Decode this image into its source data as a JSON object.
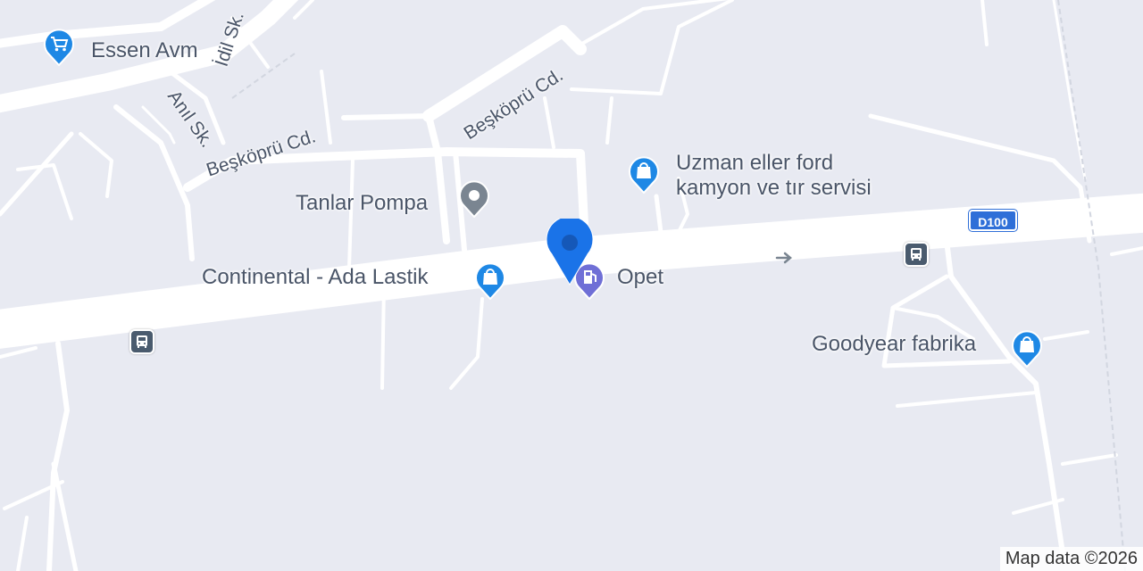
{
  "map": {
    "attribution": "Map data ©2026",
    "colors": {
      "background": "#e8eaf2",
      "road": "#ffffff",
      "poi_blue": "#1e88e5",
      "poi_gray": "#7a8591",
      "poi_fuel": "#6f6fd6",
      "location_marker": "#1a73e8",
      "highway_shield": "#2f6fd8"
    }
  },
  "highway": {
    "shield": "D100"
  },
  "streets": [
    {
      "name": "İdil Sk."
    },
    {
      "name": "Anıl Sk."
    },
    {
      "name": "Beşköprü Cd."
    },
    {
      "name": "Beşköprü Cd."
    }
  ],
  "pois": [
    {
      "name": "Essen Avm",
      "icon": "shopping-cart-icon",
      "color": "#1e88e5"
    },
    {
      "name": "Tanlar Pompa",
      "icon": "place-dot-icon",
      "color": "#7a8591"
    },
    {
      "name_line1": "Uzman eller ford",
      "name_line2": "kamyon ve tır servisi",
      "icon": "shopping-bag-icon",
      "color": "#1e88e5"
    },
    {
      "name": "Continental - Ada Lastik",
      "icon": "shopping-bag-icon",
      "color": "#1e88e5"
    },
    {
      "name": "Opet",
      "icon": "gas-station-icon",
      "color": "#6f6fd6"
    },
    {
      "name": "Goodyear fabrika",
      "icon": "shopping-bag-icon",
      "color": "#1e88e5"
    }
  ],
  "transit": {
    "icon": "bus-stop-icon",
    "count": 2
  },
  "location": {
    "icon": "location-marker-icon"
  }
}
